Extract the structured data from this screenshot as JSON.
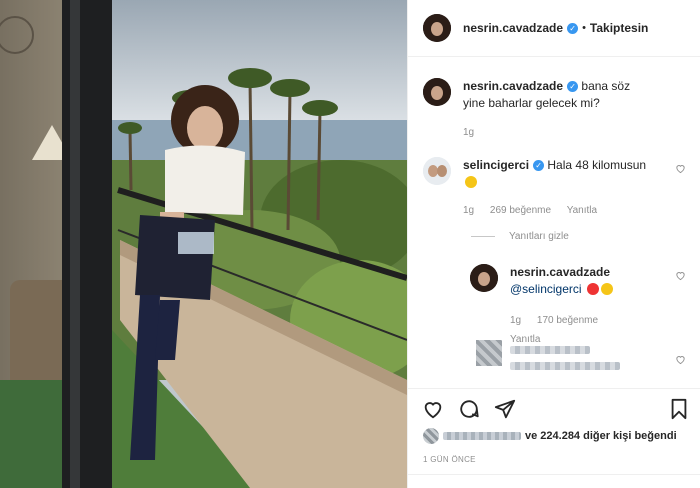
{
  "post": {
    "author": "nesrin.cavadzade",
    "follow_status": "Takiptesin",
    "separator": "•"
  },
  "caption": {
    "user": "nesrin.cavadzade",
    "text": "bana söz yine baharlar gelecek mi?",
    "age": "1g"
  },
  "comments": [
    {
      "user": "selincigerci",
      "text": "Hala 48 kilomusun",
      "age": "1g",
      "likes": "269 beğenme",
      "reply_label": "Yanıtla"
    }
  ],
  "hide_replies_label": "Yanıtları gizle",
  "reply": {
    "user": "nesrin.cavadzade",
    "mention": "@selincigerci",
    "age": "1g",
    "likes": "170 beğenme",
    "reply_label": "Yanıtla"
  },
  "likes_summary": {
    "text": "ve 224.284 diğer kişi beğendi"
  },
  "timestamp": "1 GÜN ÖNCE",
  "icons": [
    "heart-icon",
    "comment-icon",
    "share-icon",
    "bookmark-icon",
    "verified-badge-icon"
  ],
  "colors": {
    "verified": "#3897f0",
    "meta": "#8e8e8e",
    "mention": "#003569"
  }
}
